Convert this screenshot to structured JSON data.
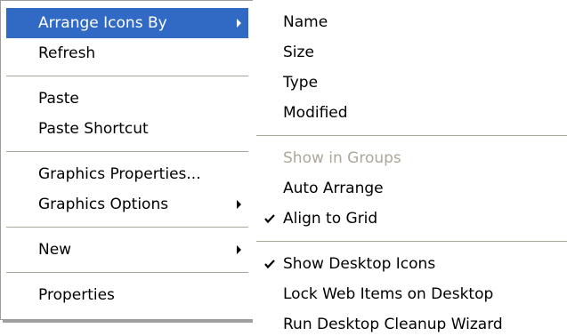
{
  "context_menu": {
    "arrange_icons_by": "Arrange Icons By",
    "refresh": "Refresh",
    "paste": "Paste",
    "paste_shortcut": "Paste Shortcut",
    "graphics_properties": "Graphics Properties...",
    "graphics_options": "Graphics Options",
    "new": "New",
    "properties": "Properties"
  },
  "arrange_submenu": {
    "name": "Name",
    "size": "Size",
    "type": "Type",
    "modified": "Modified",
    "show_in_groups": "Show in Groups",
    "auto_arrange": "Auto Arrange",
    "align_to_grid": "Align to Grid",
    "show_desktop_icons": "Show Desktop Icons",
    "lock_web_items": "Lock Web Items on Desktop",
    "run_cleanup_wizard": "Run Desktop Cleanup Wizard"
  },
  "state": {
    "highlighted_item": "Arrange Icons By",
    "disabled_items": [
      "Show in Groups"
    ],
    "checked_items": [
      "Align to Grid",
      "Show Desktop Icons"
    ]
  },
  "colors": {
    "highlight": "#316ac5",
    "disabled_text": "#aca899",
    "separator": "#aca899"
  },
  "icons": {
    "submenu_arrow": "chevron-right-icon",
    "check": "check-icon"
  }
}
